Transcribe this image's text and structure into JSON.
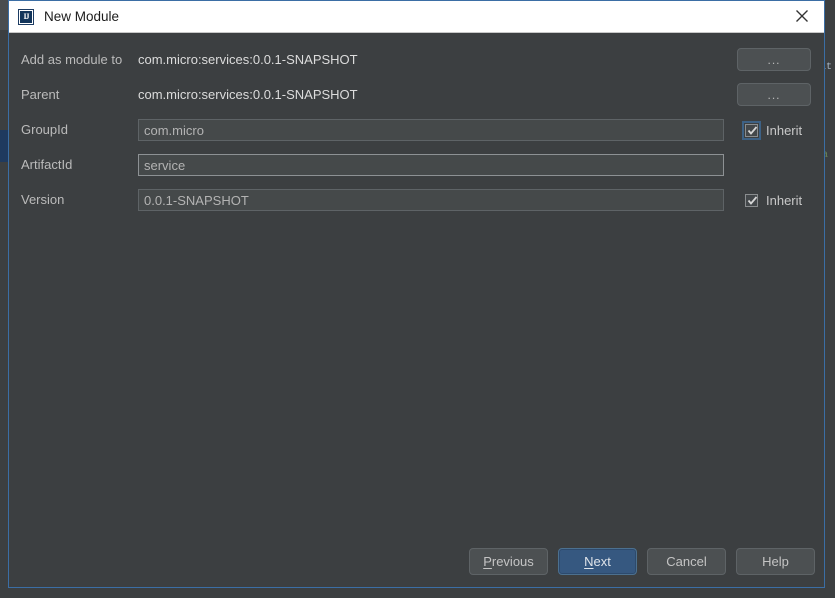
{
  "window": {
    "title": "New Module",
    "icon": "intellij-idea-icon",
    "close_label": "Close"
  },
  "form": {
    "rows": [
      {
        "label": "Add as module to",
        "kind": "static",
        "value": "com.micro:services:0.0.1-SNAPSHOT",
        "button": "..."
      },
      {
        "label": "Parent",
        "kind": "static",
        "value": "com.micro:services:0.0.1-SNAPSHOT",
        "button": "..."
      },
      {
        "label": "GroupId",
        "kind": "input",
        "value": "com.micro",
        "checkbox": "Inherit"
      },
      {
        "label": "ArtifactId",
        "kind": "input",
        "value": "service"
      },
      {
        "label": "Version",
        "kind": "input",
        "value": "0.0.1-SNAPSHOT",
        "checkbox": "Inherit"
      }
    ],
    "label_add_as_module_to": "Add as module to",
    "value_add_as_module_to": "com.micro:services:0.0.1-SNAPSHOT",
    "label_parent": "Parent",
    "value_parent": "com.micro:services:0.0.1-SNAPSHOT",
    "label_groupid": "GroupId",
    "value_groupid": "com.micro",
    "label_artifactid": "ArtifactId",
    "value_artifactid": "service",
    "label_version": "Version",
    "value_version": "0.0.1-SNAPSHOT",
    "browse_button_label": "...",
    "inherit_label": "Inherit",
    "groupid_inherit_checked": true,
    "version_inherit_checked": true
  },
  "footer": {
    "previous": "Previous",
    "previous_mnemonic": "P",
    "previous_rest": "revious",
    "next": "Next",
    "next_mnemonic": "N",
    "next_rest": "ext",
    "cancel": "Cancel",
    "help": "Help"
  },
  "colors": {
    "dialog_bg": "#3c3f41",
    "titlebar_bg": "#ffffff",
    "dialog_border": "#3b6ea5",
    "field_bg": "#45494a",
    "primary_button": "#365880",
    "label_text": "#bbbbbb"
  },
  "backdrop": {
    "right_text_1": "at",
    "right_text_2": "a"
  }
}
